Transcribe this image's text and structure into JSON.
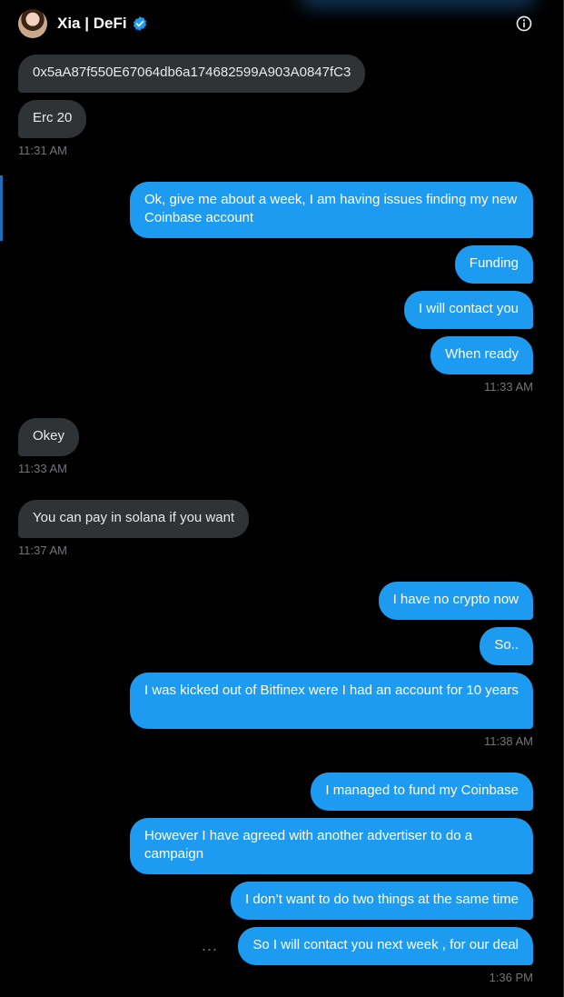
{
  "header": {
    "name": "Xia | DeFi",
    "icon": "info-icon"
  },
  "messages": {
    "m1": "0x5aA87f550E67064db6a174682599A903A0847fC3",
    "m2": "Erc 20",
    "t1": "11:31 AM",
    "m3": "Ok, give me about a week, I am having issues finding my new Coinbase account",
    "m4": "Funding",
    "m5": "I will contact you",
    "m6": "When ready",
    "t2": "11:33 AM",
    "m7": "Okey",
    "t3": "11:33 AM",
    "m8": "You can pay in solana if you want",
    "t4": "11:37 AM",
    "m9": "I have no crypto now",
    "m10": "So..",
    "m11": "I was kicked out of Bitfinex were I had an account for 10 years",
    "t5": "11:38 AM",
    "m12": "I managed to fund my Coinbase",
    "m13": "However I have agreed with another advertiser to do a campaign",
    "m14": "I don’t want to do two things at the same time",
    "m15": "So I will contact you next week , for our deal",
    "t6": "1:36 PM",
    "more": "..."
  },
  "colors": {
    "outgoing": "#1d9bf0",
    "incoming": "#2f3336",
    "background": "#000000"
  }
}
